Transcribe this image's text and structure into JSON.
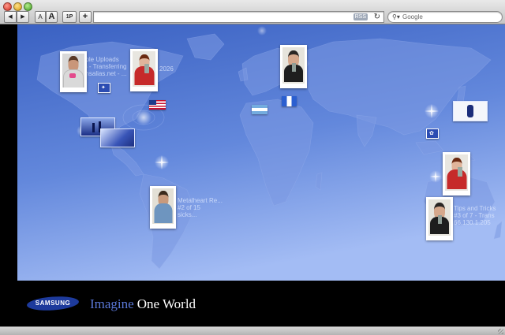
{
  "toolbar": {
    "back_label": "◀",
    "forward_label": "▶",
    "text_smaller_label": "A",
    "text_bigger_label": "A",
    "onep_label": "1P",
    "add_label": "+",
    "rss_label": "RSS",
    "reload_label": "↻",
    "search_placeholder": "Google"
  },
  "map": {
    "info_upload": {
      "line1": "pple Uploads",
      "line2": "/3 - Transferring",
      "line3": "dnsalias.net - ...",
      "line4": "2026"
    },
    "info_metal": {
      "line1": "Metalheart Re...",
      "line2": "#2 of 15",
      "line3": "sicks..."
    },
    "info_tips": {
      "line1": "Tips and Tricks",
      "line2": "#3 of 7 - Trans",
      "line3": "66.130.1.205"
    }
  },
  "footer": {
    "brand": "SAMSUNG",
    "tagline_part1": "Imagine",
    "tagline_part2": "One World"
  },
  "colors": {
    "map_dark": "#3c63c4",
    "map_light": "#9db6f2",
    "tagline_blue": "#5a78d8",
    "logo_blue": "#1d3a9c"
  }
}
